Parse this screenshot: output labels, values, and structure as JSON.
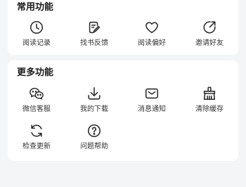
{
  "common": {
    "title": "常用功能",
    "items": [
      {
        "label": "阅读记录",
        "icon": "clock-icon"
      },
      {
        "label": "找书反馈",
        "icon": "edit-note-icon"
      },
      {
        "label": "阅读偏好",
        "icon": "heart-icon"
      },
      {
        "label": "邀请好友",
        "icon": "share-arrow-icon"
      }
    ]
  },
  "more": {
    "title": "更多功能",
    "items": [
      {
        "label": "微信客服",
        "icon": "wechat-icon"
      },
      {
        "label": "我的下载",
        "icon": "download-icon"
      },
      {
        "label": "消息通知",
        "icon": "mail-icon"
      },
      {
        "label": "清除缓存",
        "icon": "broom-icon"
      },
      {
        "label": "检查更新",
        "icon": "refresh-icon"
      },
      {
        "label": "问题帮助",
        "icon": "help-icon"
      }
    ]
  },
  "colors": {
    "icon": "#2b2b2b",
    "accent": "#e0334d",
    "background": "#f4f5f7",
    "card": "#ffffff"
  }
}
